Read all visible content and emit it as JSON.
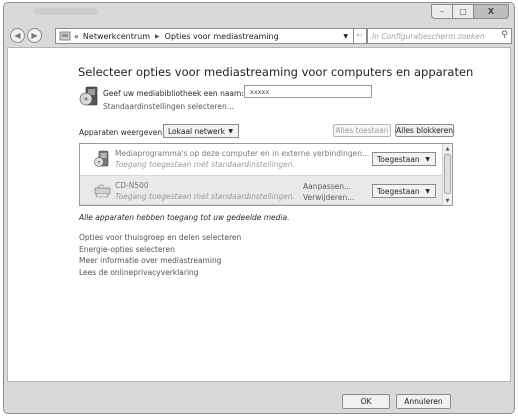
{
  "navbar": {
    "breadcrumb_prefix": "«",
    "breadcrumb_1": "Netwerkcentrum",
    "breadcrumb_2": "Opties voor mediastreaming",
    "refresh_glyph": "⁴⁺",
    "search_placeholder": "In Configuratiescherm zoeken"
  },
  "caption": {
    "minimize": "–",
    "maximize": "□",
    "close": "X"
  },
  "main": {
    "heading": "Selecteer opties voor mediastreaming voor computers en apparaten",
    "library_label": "Geef uw mediabibliotheek een naam:",
    "library_name": "xxxxx",
    "defaults_link": "Standaardinstellingen selecteren...",
    "show_devices_label": "Apparaten weergeven in:",
    "network_option": "Lokaal netwerk",
    "allow_all_button": "Alles toestaan",
    "block_all_button": "Alles blokkeren"
  },
  "devices": [
    {
      "name": "Mediaprogramma's op deze computer en in externe verbindingen...",
      "status": "Toegang toegestaan met standaardinstellingen.",
      "permission": "Toegestaan",
      "actions": []
    },
    {
      "name": "CD-N500",
      "status": "Toegang toegestaan met standaardinstellingen.",
      "permission": "Toegestaan",
      "actions": [
        "Aanpassen...",
        "Verwijderen..."
      ]
    }
  ],
  "footer_note": "Alle apparaten hebben toegang tot uw gedeelde media.",
  "links": [
    "Opties voor thuisgroep en delen selecteren",
    "Energie-opties selecteren",
    "Meer informatie over mediastreaming",
    "Lees de onlineprivacyverklaring"
  ],
  "buttons": {
    "ok": "OK",
    "cancel": "Annuleren"
  }
}
